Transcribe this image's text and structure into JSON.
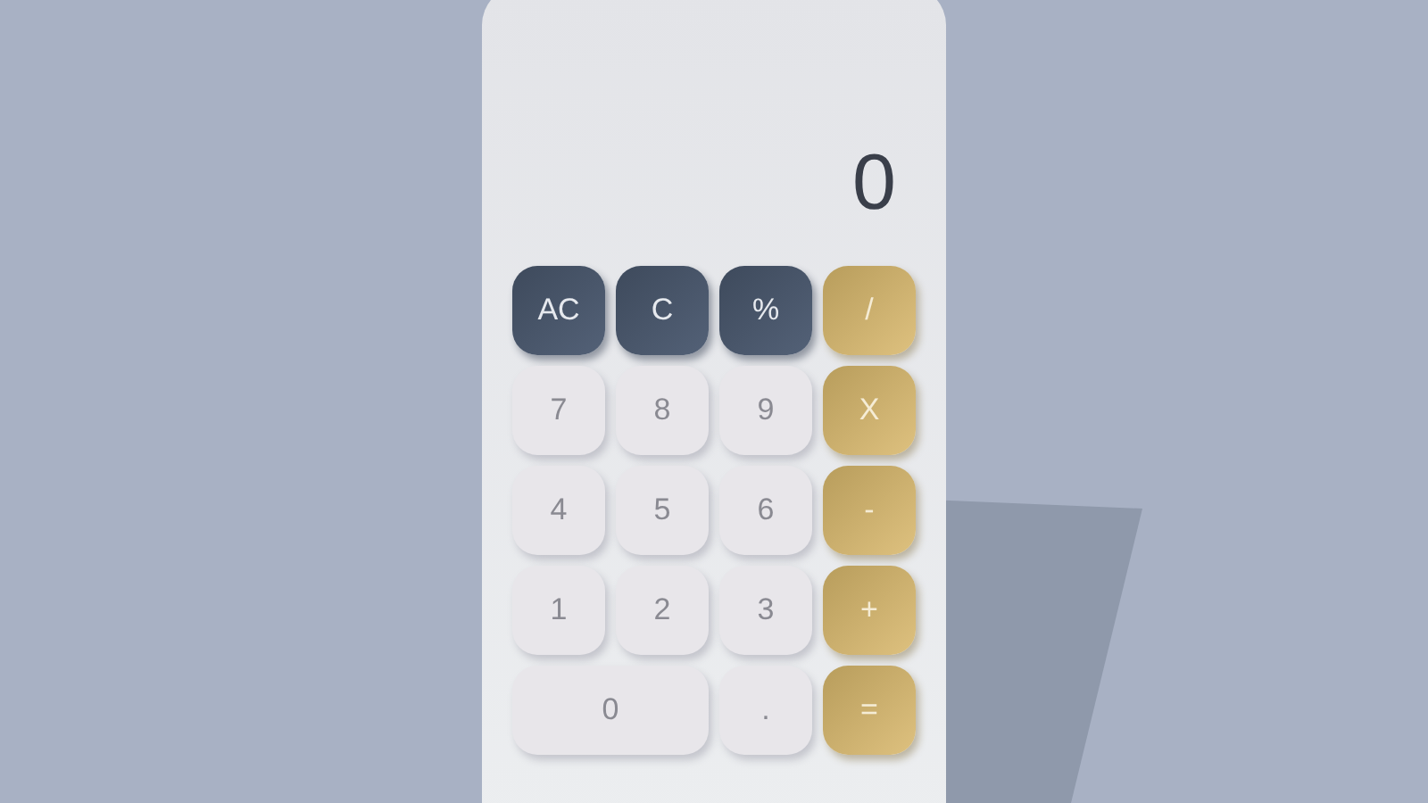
{
  "display": {
    "value": "0"
  },
  "keys": [
    {
      "label": "AC",
      "kind": "function",
      "wide": false
    },
    {
      "label": "C",
      "kind": "function",
      "wide": false
    },
    {
      "label": "%",
      "kind": "function",
      "wide": false
    },
    {
      "label": "/",
      "kind": "operator",
      "wide": false
    },
    {
      "label": "7",
      "kind": "digit",
      "wide": false
    },
    {
      "label": "8",
      "kind": "digit",
      "wide": false
    },
    {
      "label": "9",
      "kind": "digit",
      "wide": false
    },
    {
      "label": "X",
      "kind": "operator",
      "wide": false
    },
    {
      "label": "4",
      "kind": "digit",
      "wide": false
    },
    {
      "label": "5",
      "kind": "digit",
      "wide": false
    },
    {
      "label": "6",
      "kind": "digit",
      "wide": false
    },
    {
      "label": "-",
      "kind": "operator",
      "wide": false
    },
    {
      "label": "1",
      "kind": "digit",
      "wide": false
    },
    {
      "label": "2",
      "kind": "digit",
      "wide": false
    },
    {
      "label": "3",
      "kind": "digit",
      "wide": false
    },
    {
      "label": "+",
      "kind": "operator",
      "wide": false
    },
    {
      "label": "0",
      "kind": "digit",
      "wide": true
    },
    {
      "label": ".",
      "kind": "digit",
      "wide": false
    },
    {
      "label": "=",
      "kind": "operator",
      "wide": false
    }
  ]
}
